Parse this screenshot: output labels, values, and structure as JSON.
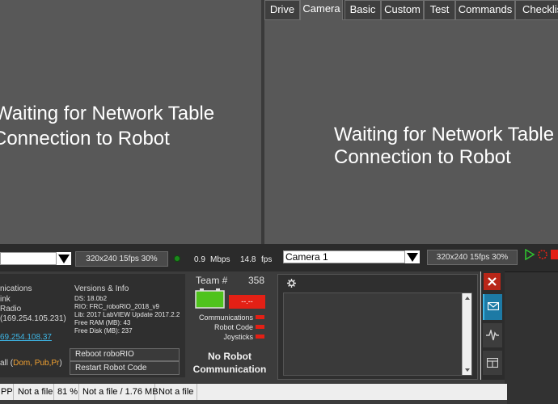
{
  "top": {
    "left_message_line1": "Waiting for Network Table",
    "left_message_line2": "Connection to Robot",
    "right_message_line1": "Waiting for Network Table",
    "right_message_line2": "Connection to Robot",
    "tabs": [
      {
        "label": "Drive"
      },
      {
        "label": "Camera"
      },
      {
        "label": "Basic"
      },
      {
        "label": "Custom"
      },
      {
        "label": "Test"
      },
      {
        "label": "Commands"
      },
      {
        "label": "Checklist"
      }
    ],
    "active_tab": "Camera"
  },
  "stream_bar": {
    "left_camera_value": "",
    "left_resolution": "320x240   15fps   30%",
    "bandwidth_value": "0.9",
    "bandwidth_unit": "Mbps",
    "fps_value": "14.8",
    "fps_unit": "fps",
    "right_camera_value": "Camera 1",
    "right_resolution": "320x240   15fps   30%"
  },
  "diagnostics": {
    "comm_title": "nications",
    "line_link": "ink",
    "line_radio": "Radio",
    "line_ip": "(169.254.105.231)",
    "line_ip2": "69.254.108.37",
    "versions_title": "Versions & Info",
    "ds": "DS:  18.0b2",
    "rio": "RIO:  FRC_roboRIO_2018_v9",
    "lib": "Lib:  2017 LabVIEW Update 2017.2.2",
    "free_ram": "Free RAM (MB): 43",
    "free_disk": "Free Disk (MB): 237",
    "all_prefix": "all (",
    "all_links": "Dom, Pub,Pr",
    "all_suffix": ")",
    "reboot_button": "Reboot roboRIO",
    "restart_button": "Restart Robot Code"
  },
  "team": {
    "label": "Team #",
    "number": "358",
    "battery_display": "--.--",
    "communications_label": "Communications",
    "robot_code_label": "Robot Code",
    "joysticks_label": "Joysticks",
    "status_line1": "No Robot",
    "status_line2": "Communication"
  },
  "status_bar": {
    "cells": [
      "PP",
      "Not a file",
      "81 %",
      "Not a file / 1.76 MB",
      "Not a file"
    ]
  },
  "colors": {
    "battery_green": "#4fc31c",
    "error_red": "#e32015",
    "link_cyan": "#3db6e6",
    "link_orange": "#f0a030"
  }
}
